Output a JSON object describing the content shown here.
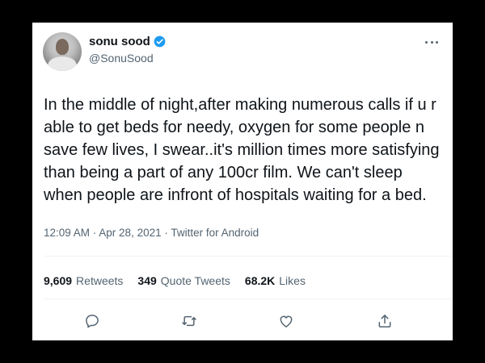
{
  "user": {
    "display_name": "sonu sood",
    "handle": "@SonuSood",
    "verified": true
  },
  "tweet": {
    "lines": [
      "In the middle of night,after making numerous calls if u r",
      "able to get beds for needy, oxygen for some people n",
      "save few lives, I swear..it's million times more satisfying",
      "than being a part of any 100cr film. We can't sleep",
      "when people are infront of hospitals waiting for a bed."
    ],
    "meta": "12:09 AM · Apr 28, 2021 · Twitter for Android"
  },
  "stats": {
    "retweets_count": "9,609",
    "retweets_label": "Retweets",
    "quotes_count": "349",
    "quotes_label": "Quote Tweets",
    "likes_count": "68.2K",
    "likes_label": "Likes"
  },
  "icons": {
    "reply": "reply-icon",
    "retweet": "retweet-icon",
    "like": "like-icon",
    "share": "share-icon",
    "more": "more-icon",
    "verified": "verified-badge-icon"
  },
  "colors": {
    "background": "#000000",
    "card": "#ffffff",
    "text": "#0f1419",
    "secondary": "#536471",
    "verified": "#1d9bf0"
  }
}
